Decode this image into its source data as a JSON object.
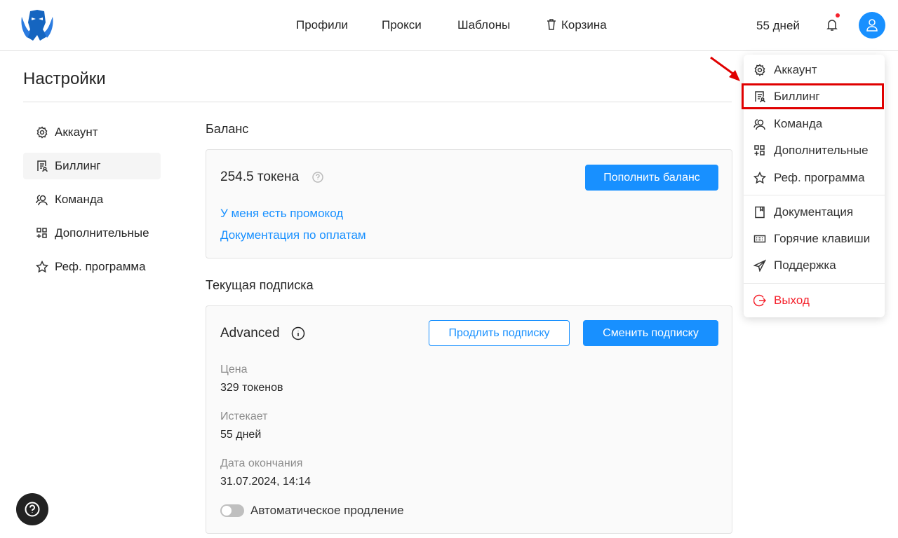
{
  "header": {
    "logo": "octopus-logo",
    "nav": [
      "Профили",
      "Прокси",
      "Шаблоны",
      "Корзина"
    ],
    "days_left": "55 дней",
    "notification_dot_color": "#f5222d",
    "avatar_color": "#1890ff"
  },
  "page": {
    "title": "Настройки"
  },
  "sidebar": {
    "items": [
      {
        "label": "Аккаунт",
        "icon": "gear-icon"
      },
      {
        "label": "Биллинг",
        "icon": "billing-icon",
        "active": true
      },
      {
        "label": "Команда",
        "icon": "team-icon"
      },
      {
        "label": "Дополнительные",
        "icon": "apps-icon"
      },
      {
        "label": "Реф. программа",
        "icon": "star-icon"
      }
    ]
  },
  "balance": {
    "heading": "Баланс",
    "amount": "254.5 токена",
    "topup_button": "Пополнить баланс",
    "promo_link": "У меня есть промокод",
    "docs_link": "Документация по оплатам"
  },
  "subscription": {
    "heading": "Текущая подписка",
    "plan": "Advanced",
    "extend_button": "Продлить подписку",
    "change_button": "Сменить подписку",
    "price_label": "Цена",
    "price_value": "329 токенов",
    "expires_label": "Истекает",
    "expires_value": "55 дней",
    "end_label": "Дата окончания",
    "end_value": "31.07.2024, 14:14",
    "auto_renew_label": "Автоматическое продление",
    "auto_renew": false
  },
  "menu": {
    "items": [
      "Аккаунт",
      "Биллинг",
      "Команда",
      "Дополнительные",
      "Реф. программа",
      "Документация",
      "Горячие клавиши",
      "Поддержка",
      "Выход"
    ],
    "highlighted": "Биллинг",
    "highlight_color": "#e00000",
    "logout_color": "#f5222d"
  },
  "colors": {
    "primary": "#1890ff"
  }
}
